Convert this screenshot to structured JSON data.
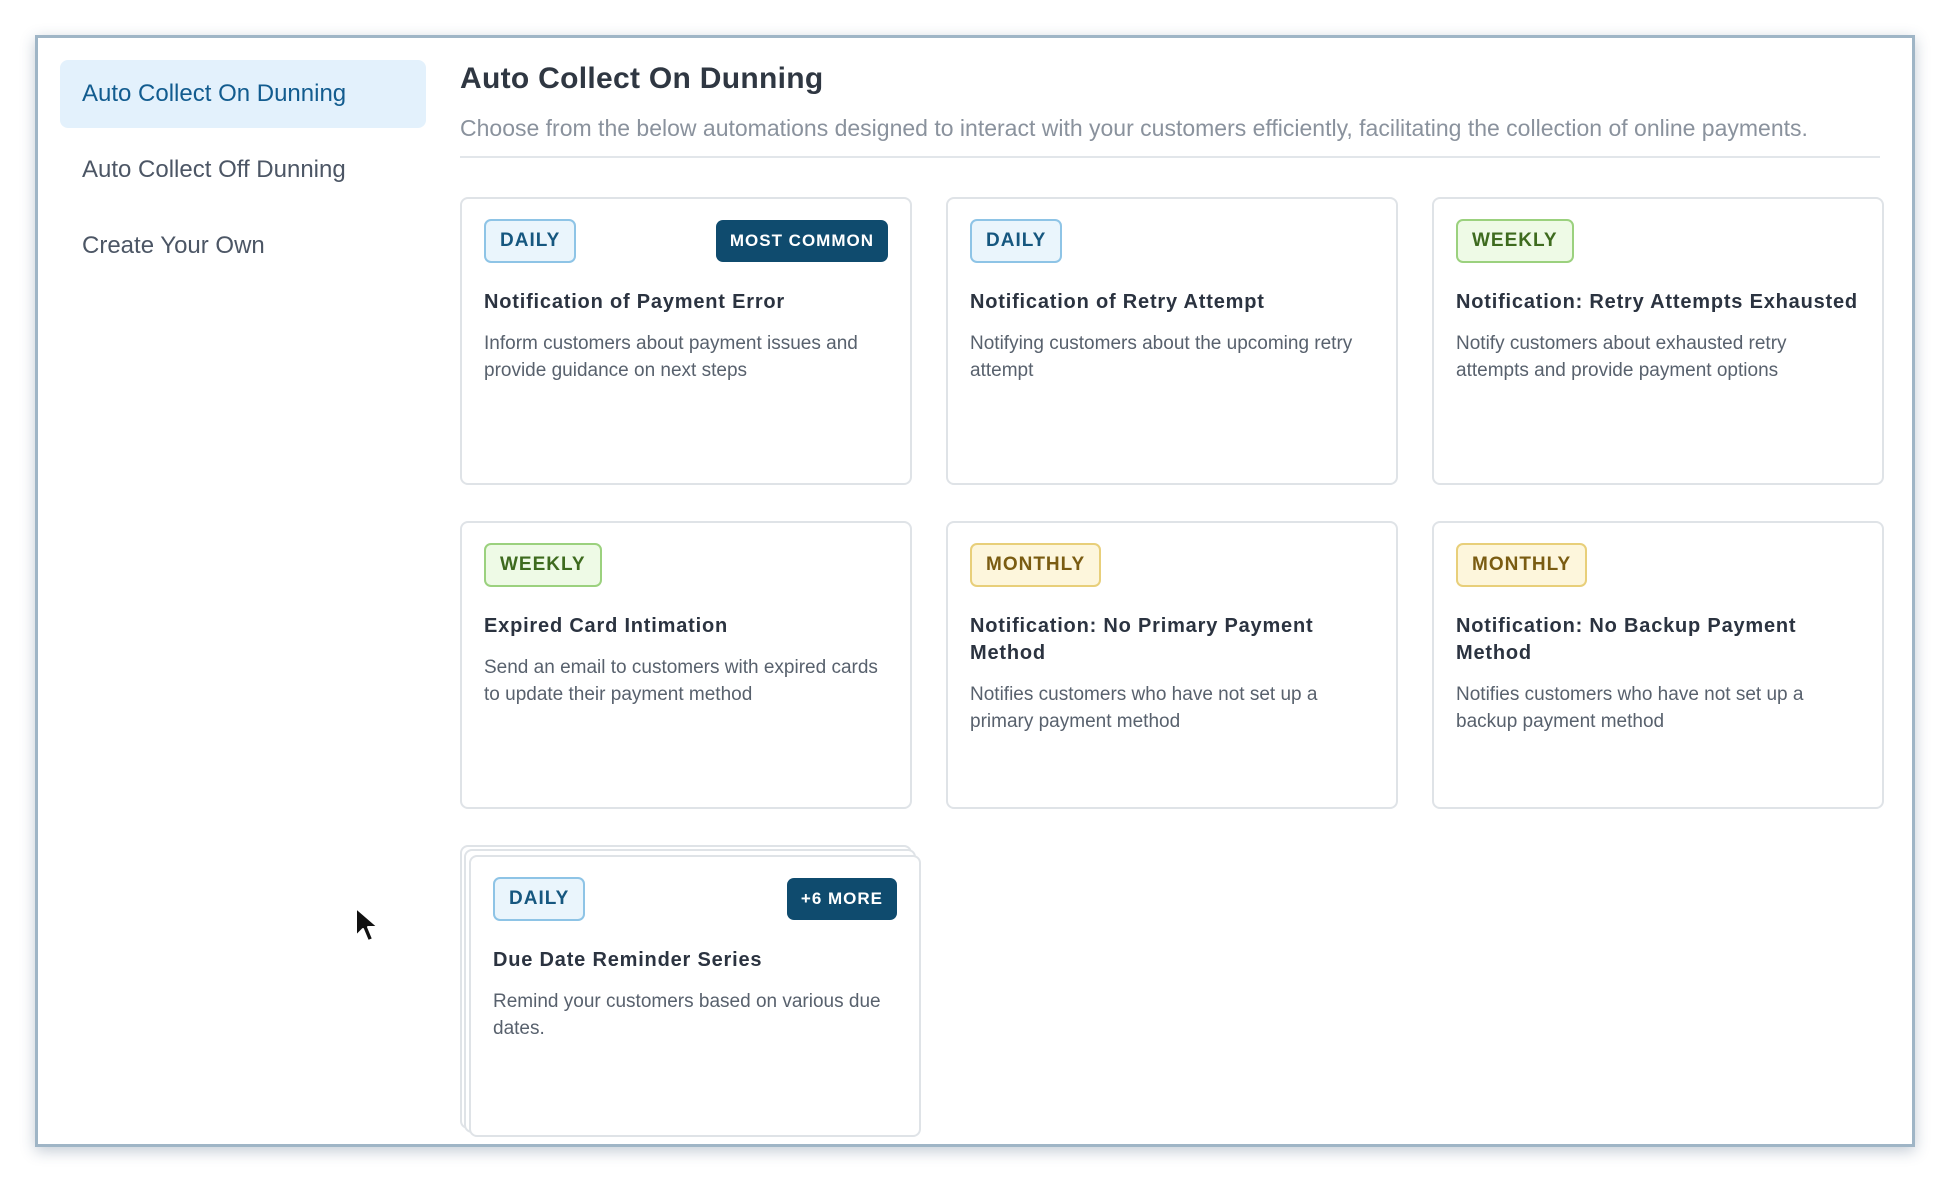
{
  "sidebar": {
    "items": [
      {
        "label": "Auto Collect On Dunning",
        "active": true
      },
      {
        "label": "Auto Collect Off Dunning",
        "active": false
      },
      {
        "label": "Create Your Own",
        "active": false
      }
    ]
  },
  "main": {
    "title": "Auto Collect On Dunning",
    "subtitle": "Choose from the below automations designed to interact with your customers efficiently, facilitating the collection of online payments."
  },
  "cards": [
    {
      "frequency": "DAILY",
      "tag": "MOST COMMON",
      "title": "Notification of Payment Error",
      "description": "Inform customers about payment issues and provide guidance on next steps"
    },
    {
      "frequency": "DAILY",
      "tag": "",
      "title": "Notification of Retry Attempt",
      "description": "Notifying customers about the upcoming retry attempt"
    },
    {
      "frequency": "WEEKLY",
      "tag": "",
      "title": "Notification: Retry Attempts Exhausted",
      "description": "Notify customers about exhausted retry attempts and provide payment options"
    },
    {
      "frequency": "WEEKLY",
      "tag": "",
      "title": "Expired Card Intimation",
      "description": "Send an email to customers with expired cards to update their payment method"
    },
    {
      "frequency": "MONTHLY",
      "tag": "",
      "title": "Notification: No Primary Payment Method",
      "description": "Notifies customers who have not set up a primary payment method"
    },
    {
      "frequency": "MONTHLY",
      "tag": "",
      "title": "Notification: No Backup Payment Method",
      "description": "Notifies customers who have not set up a backup payment method"
    },
    {
      "frequency": "DAILY",
      "tag": "+6 MORE",
      "title": "Due Date Reminder Series",
      "description": "Remind your customers based on various due dates."
    }
  ],
  "colors": {
    "accent": "#0f4b6e",
    "active_bg": "#e3f1fc",
    "daily": "#16577f",
    "weekly": "#3e6b1f",
    "monthly": "#7a5c12"
  },
  "icons": {
    "cursor": "mouse-pointer-icon"
  }
}
